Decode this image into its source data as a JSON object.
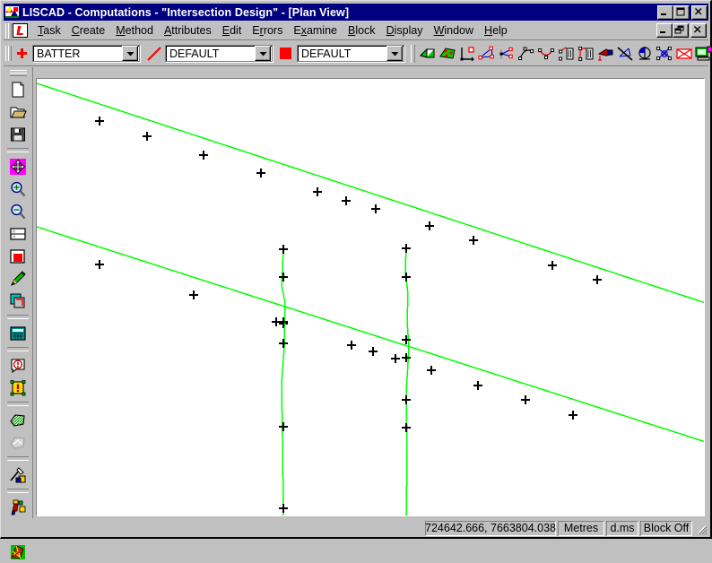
{
  "window": {
    "title": "LISCAD - Computations - \"Intersection Design\" - [Plan View]",
    "icon": "liscad-app-icon",
    "controls": {
      "minimize": "_",
      "maximize": "□",
      "close": "×"
    },
    "mdi_controls": {
      "minimize": "_",
      "restore": "❐",
      "close": "×"
    }
  },
  "menubar": {
    "logo_icon": "liscad-l-logo-icon",
    "items": [
      {
        "label": "Task",
        "accel": "T"
      },
      {
        "label": "Create",
        "accel": "C"
      },
      {
        "label": "Method",
        "accel": "M"
      },
      {
        "label": "Attributes",
        "accel": "A"
      },
      {
        "label": "Edit",
        "accel": "E"
      },
      {
        "label": "Errors",
        "accel": "r"
      },
      {
        "label": "Examine",
        "accel": "x"
      },
      {
        "label": "Block",
        "accel": "B"
      },
      {
        "label": "Display",
        "accel": "D"
      },
      {
        "label": "Window",
        "accel": "W"
      },
      {
        "label": "Help",
        "accel": "H"
      }
    ]
  },
  "toolbar": {
    "point_icon": "red-cross-point-icon",
    "line_icon": "red-diagonal-line-icon",
    "fill_icon": "red-filled-square-icon",
    "combos": [
      {
        "name": "point-attribute-combo",
        "value": "BATTER",
        "arrow": "▼"
      },
      {
        "name": "line-attribute-combo",
        "value": "DEFAULT",
        "arrow": "▼"
      },
      {
        "name": "fill-attribute-combo",
        "value": "DEFAULT",
        "arrow": "▼"
      }
    ],
    "buttons": [
      "copy-surface-icon",
      "paste-surface-icon",
      "axes-origin-icon",
      "triangulate-icon",
      "triangulate-partial-icon",
      "arc-three-point-icon",
      "curve-fit-icon",
      "delete-above-icon",
      "insert-above-icon",
      "draw-profile-icon",
      "clear-triangles-icon",
      "circle-tangent-icon",
      "intersect-points-icon",
      "cross-box-icon",
      "computer-output-icon"
    ]
  },
  "left_toolbar": {
    "buttons": [
      "new-file-icon",
      "open-folder-icon",
      "save-disk-icon",
      "pan-move-icon",
      "zoom-in-icon",
      "zoom-out-icon",
      "window-view-icon",
      "red-square-fill-icon",
      "pencil-edit-icon",
      "copy-layers-icon",
      "calculator-icon",
      "error-circle-icon",
      "warning-square-icon",
      "green-hatched-surface-icon",
      "grey-surface-disabled-icon",
      "tools-settings-icon",
      "survey-figure-icon",
      "profile-chart-icon",
      "textured-surface-icon"
    ]
  },
  "statusbar": {
    "coordinates": "724642.666, 7663804.038",
    "units": "Metres",
    "angle_format": "d.ms",
    "block_state": "Block Off",
    "resize_grip": "resize-grip-icon"
  },
  "chart_data": {
    "type": "scatter",
    "title": "Plan View",
    "xlabel": "",
    "ylabel": "",
    "grid": false,
    "legend": null,
    "background": "#ffffff",
    "line_color": "#00ff00",
    "marker_color": "#000000",
    "marker": "plus-cross",
    "axis_note": "Plan view in metres; no axes or tick labels are drawn on the canvas.",
    "view_width": 746,
    "view_height": 489,
    "series": [
      {
        "name": "upper-alignment-string",
        "type": "polyline",
        "points": [
          [
            0,
            5
          ],
          [
            746,
            250
          ]
        ],
        "markers": [
          [
            70,
            47
          ],
          [
            123,
            64
          ],
          [
            186,
            85
          ],
          [
            250,
            105
          ],
          [
            313,
            126
          ],
          [
            345,
            136
          ],
          [
            378,
            145
          ],
          [
            438,
            164
          ],
          [
            487,
            180
          ],
          [
            575,
            208
          ],
          [
            625,
            224
          ]
        ]
      },
      {
        "name": "lower-alignment-string",
        "type": "polyline",
        "points": [
          [
            0,
            165
          ],
          [
            746,
            405
          ]
        ],
        "markers": [
          [
            70,
            207
          ],
          [
            175,
            241
          ],
          [
            267,
            271
          ],
          [
            275,
            273
          ],
          [
            351,
            297
          ],
          [
            375,
            304
          ],
          [
            400,
            312
          ],
          [
            440,
            325
          ],
          [
            492,
            342
          ],
          [
            545,
            358
          ],
          [
            598,
            375
          ]
        ]
      },
      {
        "name": "left-cross-section-string",
        "type": "polyline-vertical",
        "points": [
          [
            275,
            186
          ],
          [
            274,
            215
          ],
          [
            273,
            230
          ],
          [
            277,
            250
          ],
          [
            276,
            300
          ],
          [
            273,
            340
          ],
          [
            274,
            400
          ],
          [
            275,
            489
          ]
        ],
        "markers": [
          [
            275,
            190
          ],
          [
            275,
            221
          ],
          [
            275,
            271
          ],
          [
            275,
            295
          ],
          [
            275,
            388
          ],
          [
            275,
            479
          ]
        ]
      },
      {
        "name": "right-cross-section-string",
        "type": "polyline-vertical",
        "points": [
          [
            412,
            185
          ],
          [
            411,
            215
          ],
          [
            414,
            240
          ],
          [
            413,
            270
          ],
          [
            415,
            300
          ],
          [
            412,
            350
          ],
          [
            413,
            420
          ],
          [
            412,
            489
          ]
        ],
        "markers": [
          [
            412,
            189
          ],
          [
            412,
            221
          ],
          [
            412,
            291
          ],
          [
            412,
            311
          ],
          [
            412,
            358
          ],
          [
            412,
            389
          ]
        ]
      }
    ]
  }
}
